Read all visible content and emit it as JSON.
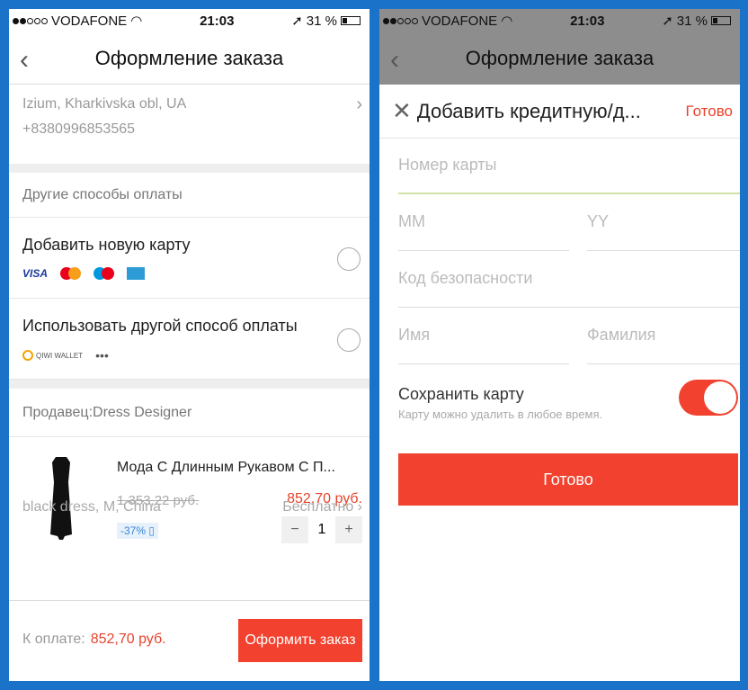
{
  "status": {
    "carrier": "VODAFONE",
    "time": "21:03",
    "battery": "31 %"
  },
  "nav": {
    "title": "Оформление заказа"
  },
  "address": {
    "line1": "Izium, Kharkivska obl, UA",
    "phone": "+8380996853565"
  },
  "payment": {
    "section_label": "Другие способы оплаты",
    "add_card_label": "Добавить новую карту",
    "other_method_label": "Использовать другой способ оплаты",
    "visa_text": "VISA",
    "qiwi_text": "QIWI WALLET",
    "more_text": "•••"
  },
  "seller": {
    "label": "Продавец:Dress Designer"
  },
  "product": {
    "title": "Мода С Длинным Рукавом С П...",
    "old_price": "1 353,22 руб.",
    "new_price": "852,70 руб.",
    "discount": "-37%",
    "qty_minus": "−",
    "qty": "1",
    "qty_plus": "+",
    "variant": "black dress, M, China",
    "shipping": "Бесплатно ›"
  },
  "footer": {
    "to_pay_label": "К оплате:",
    "to_pay_value": "852,70 руб.",
    "order_button": "Оформить заказ"
  },
  "card_form": {
    "title": "Добавить кредитную/д...",
    "done_link": "Готово",
    "card_number_placeholder": "Номер карты",
    "mm_placeholder": "MM",
    "yy_placeholder": "YY",
    "cvv_placeholder": "Код безопасности",
    "first_name_placeholder": "Имя",
    "last_name_placeholder": "Фамилия",
    "save_card_label": "Сохранить карту",
    "save_card_hint": "Карту можно удалить в любое время.",
    "save_card_on": true,
    "submit_button": "Готово"
  },
  "colors": {
    "accent": "#f2422f",
    "frame": "#1a73c9"
  }
}
